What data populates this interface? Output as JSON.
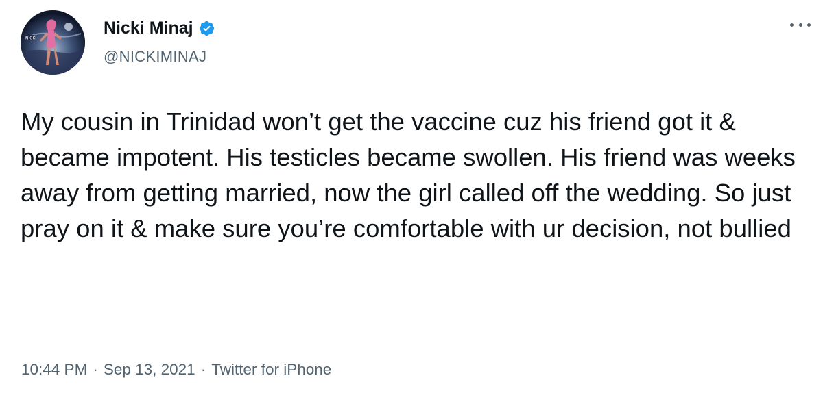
{
  "tweet": {
    "author": {
      "display_name": "Nicki Minaj",
      "handle": "@NICKIMINAJ",
      "verified": true,
      "verified_icon": "verified-badge-icon",
      "avatar_label": "NICKI"
    },
    "text": "My cousin in Trinidad won’t get the vaccine cuz his friend got it & became impotent. His testicles became swollen. His friend was weeks away from getting married, now the girl called off the wedding. So just pray on it & make sure you’re comfortable with ur decision, not bullied",
    "time": "10:44 PM",
    "date": "Sep 13, 2021",
    "separator": "·",
    "source": "Twitter for iPhone",
    "more_icon": "more-horizontal-icon"
  },
  "colors": {
    "primary_text": "#0f1419",
    "secondary_text": "#536471",
    "verified": "#1d9bf0",
    "background": "#ffffff"
  }
}
